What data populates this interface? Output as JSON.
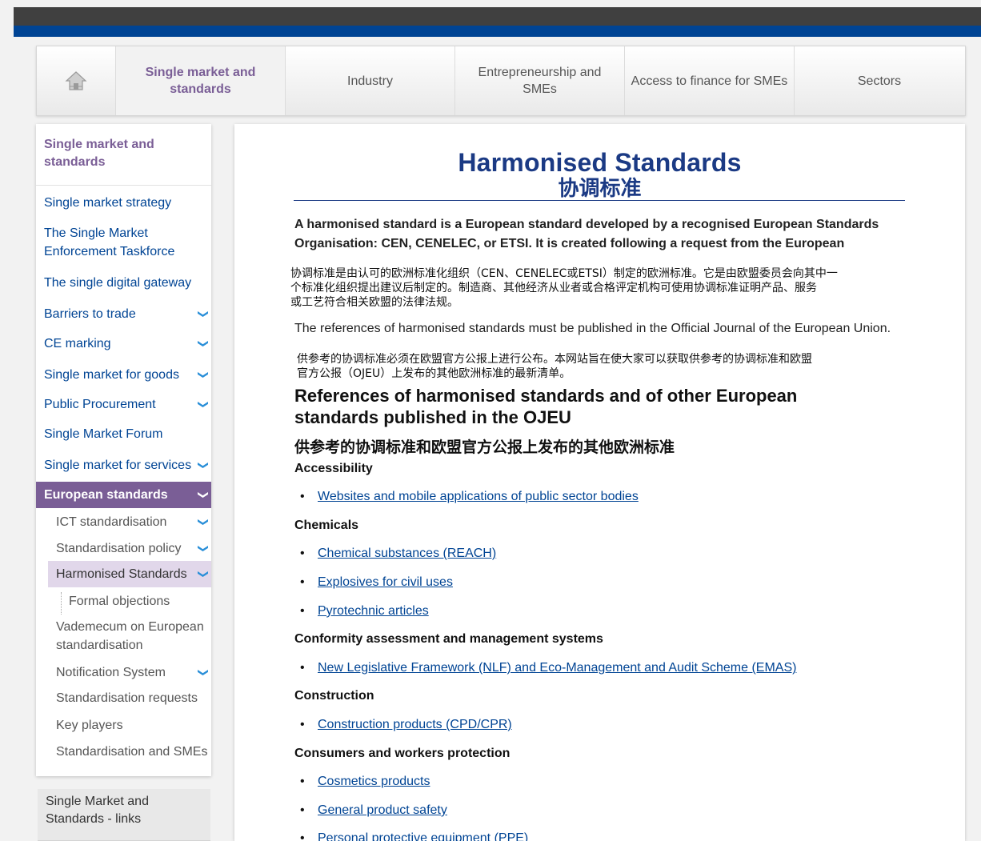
{
  "nav": {
    "home_icon": "home-icon",
    "items": [
      {
        "label": "Single market and standards",
        "active": true
      },
      {
        "label": "Industry"
      },
      {
        "label": "Entrepreneurship and SMEs"
      },
      {
        "label": "Access to finance for SMEs"
      },
      {
        "label": "Sectors"
      }
    ]
  },
  "sidebar": {
    "heading": "Single market and standards",
    "items": [
      "Single market strategy",
      "The Single Market Enforcement Taskforce",
      "The single digital gateway",
      "Barriers to trade",
      "CE marking",
      "Single market for goods",
      "Public Procurement",
      "Single Market Forum",
      "Single market for services",
      "European standards"
    ],
    "subitems": [
      "ICT standardisation",
      "Standardisation policy",
      "Harmonised Standards",
      "Formal objections",
      "Vademecum on European standardisation",
      "Notification System",
      "Standardisation requests",
      "Key players",
      "Standardisation and SMEs"
    ],
    "links_box": "Single Market and Standards - links"
  },
  "main": {
    "title": "Harmonised Standards",
    "title_cn": "协调标准",
    "intro_1": "A harmonised standard is a European standard developed by a recognised European Standards",
    "intro_2": "Organisation: CEN, CENELEC, or ETSI. It is created following a request from the European",
    "intro_cn_1": "协调标准是由认可的欧洲标准化组织（CEN、CENELEC或ETSI）制定的欧洲标准。它是由欧盟委员会向其中一",
    "intro_cn_2": "个标准化组织提出建议后制定的。制造商、其他经济从业者或合格评定机构可使用协调标准证明产品、服务",
    "intro_cn_3": "或工艺符合相关欧盟的法律法规。",
    "refs_text": "The references of harmonised standards must be published in the Official Journal of the European Union.",
    "refs_cn_1": "供参考的协调标准必须在欧盟官方公报上进行公布。本网站旨在使大家可以获取供参考的协调标准和欧盟",
    "refs_cn_2": "官方公报（OJEU）上发布的其他欧洲标准的最新清单。",
    "section_title_1": "References of harmonised standards and of other European",
    "section_title_2": "standards published in the OJEU",
    "section_title_cn": "供参考的协调标准和欧盟官方公报上发布的其他欧洲标准",
    "categories": [
      {
        "heading": "Accessibility",
        "links": [
          "Websites and mobile applications of public sector bodies"
        ]
      },
      {
        "heading": "Chemicals",
        "links": [
          "Chemical substances (REACH)",
          "Explosives for civil uses",
          "Pyrotechnic articles"
        ]
      },
      {
        "heading": "Conformity assessment and management systems",
        "links": [
          "New Legislative Framework (NLF) and Eco-Management and Audit Scheme (EMAS)"
        ]
      },
      {
        "heading": "Construction",
        "links": [
          "Construction products (CPD/CPR)"
        ]
      },
      {
        "heading": "Consumers and workers protection",
        "links": [
          "Cosmetics products",
          "General product safety",
          "Personal protective equipment (PPE)"
        ]
      }
    ]
  }
}
